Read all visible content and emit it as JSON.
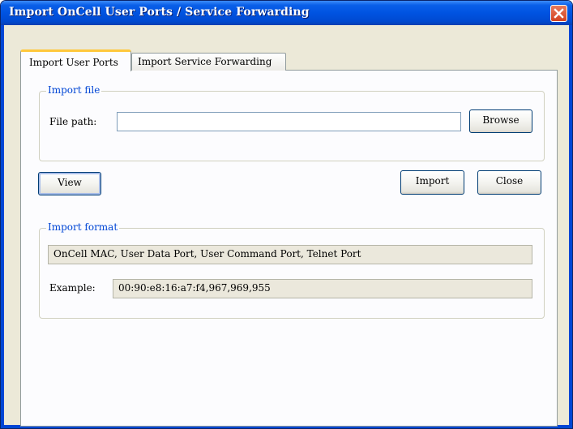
{
  "window": {
    "title": "Import OnCell User Ports / Service Forwarding"
  },
  "tabs": [
    {
      "label": "Import User Ports",
      "active": true
    },
    {
      "label": "Import Service Forwarding",
      "active": false
    }
  ],
  "import_file": {
    "legend": "Import file",
    "file_path_label": "File path:",
    "file_path_value": "",
    "browse_label": "Browse"
  },
  "actions": {
    "view_label": "View",
    "import_label": "Import",
    "close_label": "Close"
  },
  "import_format": {
    "legend": "Import format",
    "format_text": "OnCell MAC, User Data Port, User Command Port, Telnet Port",
    "example_label": "Example:",
    "example_value": "00:90:e8:16:a7:f4,967,969,955"
  },
  "colors": {
    "title_bar": "#0053e1",
    "close_button": "#d3411f",
    "group_label": "#0046d5",
    "tab_highlight": "#ffc83c"
  },
  "icons": {
    "close": "close-icon"
  }
}
